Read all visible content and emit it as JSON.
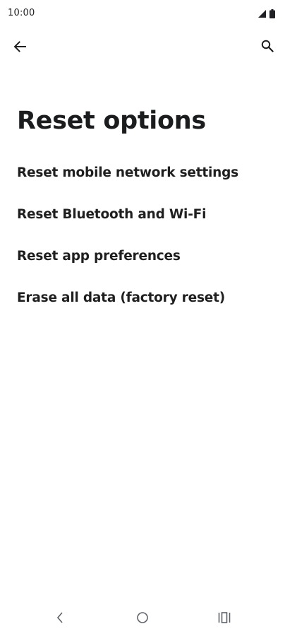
{
  "status_bar": {
    "time": "10:00",
    "icons": [
      "signal-icon",
      "battery-icon"
    ]
  },
  "app_bar": {
    "back_icon": "arrow-left-icon",
    "search_icon": "search-icon"
  },
  "page": {
    "title": "Reset options"
  },
  "options": [
    {
      "label": "Reset mobile network settings"
    },
    {
      "label": "Reset Bluetooth and Wi-Fi"
    },
    {
      "label": "Reset app preferences"
    },
    {
      "label": "Erase all data (factory reset)"
    }
  ],
  "nav_bar": {
    "icons": [
      "nav-back-icon",
      "nav-home-icon",
      "nav-recents-icon"
    ]
  },
  "colors": {
    "background": "#ffffff",
    "text": "#1f1f1f",
    "icon": "#3c3c3c"
  }
}
